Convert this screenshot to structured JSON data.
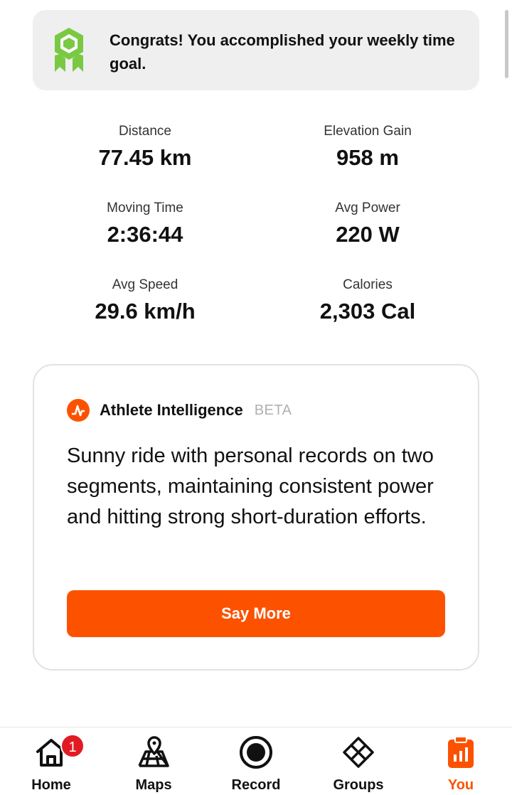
{
  "congrats": {
    "message": "Congrats! You accomplished your weekly time goal."
  },
  "stats": [
    {
      "label": "Distance",
      "value": "77.45 km"
    },
    {
      "label": "Elevation Gain",
      "value": "958 m"
    },
    {
      "label": "Moving Time",
      "value": "2:36:44"
    },
    {
      "label": "Avg Power",
      "value": "220 W"
    },
    {
      "label": "Avg Speed",
      "value": "29.6 km/h"
    },
    {
      "label": "Calories",
      "value": "2,303 Cal"
    }
  ],
  "athlete_intelligence": {
    "title": "Athlete Intelligence",
    "badge": "BETA",
    "summary": "Sunny ride with personal records on two segments, maintaining consistent power and hitting strong short-duration efforts.",
    "button_label": "Say More"
  },
  "tabbar": {
    "items": [
      {
        "label": "Home",
        "icon": "home-icon",
        "badge": "1"
      },
      {
        "label": "Maps",
        "icon": "map-icon"
      },
      {
        "label": "Record",
        "icon": "record-icon"
      },
      {
        "label": "Groups",
        "icon": "groups-icon"
      },
      {
        "label": "You",
        "icon": "you-icon",
        "active": true
      }
    ]
  },
  "colors": {
    "accent": "#fc5200",
    "badge_green": "#7ac943",
    "notification_red": "#e21b23",
    "banner_bg": "#efefef"
  }
}
